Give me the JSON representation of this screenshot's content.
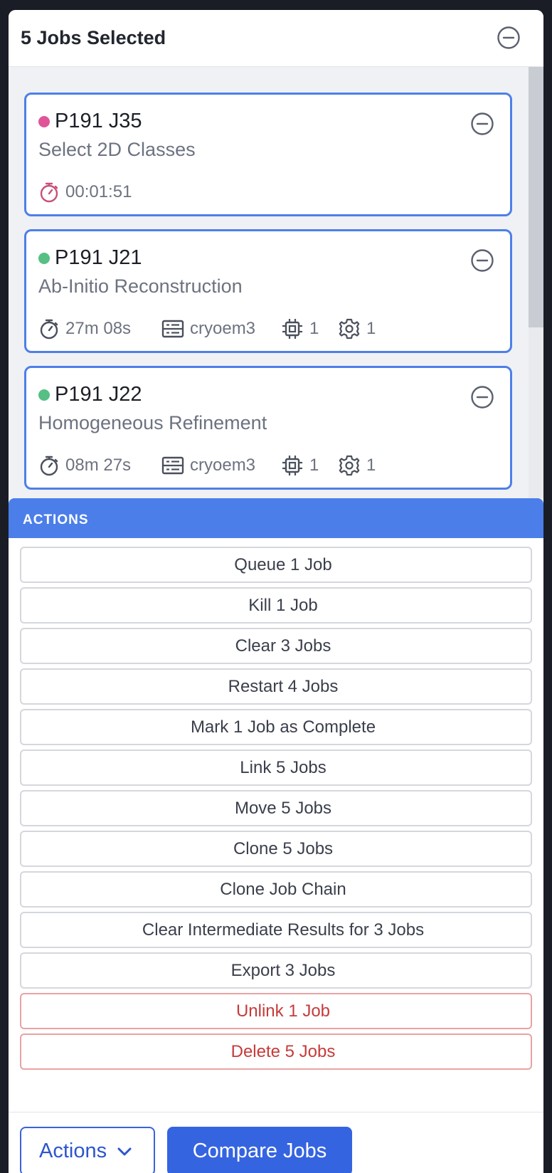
{
  "header": {
    "title": "5 Jobs Selected"
  },
  "jobs": [
    {
      "id": "P191 J35",
      "type": "Select 2D Classes",
      "status_color": "#e0559a",
      "time": "00:01:51",
      "time_color": "#c94f7c"
    },
    {
      "id": "P191 J21",
      "type": "Ab-Initio Reconstruction",
      "status_color": "#56bf84",
      "time": "27m 08s",
      "lane": "cryoem3",
      "gpus": "1",
      "threads": "1"
    },
    {
      "id": "P191 J22",
      "type": "Homogeneous Refinement",
      "status_color": "#56bf84",
      "time": "08m 27s",
      "lane": "cryoem3",
      "gpus": "1",
      "threads": "1"
    }
  ],
  "actions": {
    "title": "ACTIONS",
    "items": [
      "Queue 1 Job",
      "Kill 1 Job",
      "Clear 3 Jobs",
      "Restart 4 Jobs",
      "Mark 1 Job as Complete",
      "Link 5 Jobs",
      "Move 5 Jobs",
      "Clone 5 Jobs",
      "Clone Job Chain",
      "Clear Intermediate Results for 3 Jobs",
      "Export 3 Jobs"
    ],
    "danger_items": [
      "Unlink 1 Job",
      "Delete 5 Jobs"
    ]
  },
  "footer": {
    "actions_label": "Actions",
    "compare_label": "Compare Jobs"
  },
  "icons": [
    "minus-circle-icon",
    "stopwatch-icon",
    "server-icon",
    "cpu-icon",
    "gear-icon",
    "chevron-down-icon"
  ]
}
